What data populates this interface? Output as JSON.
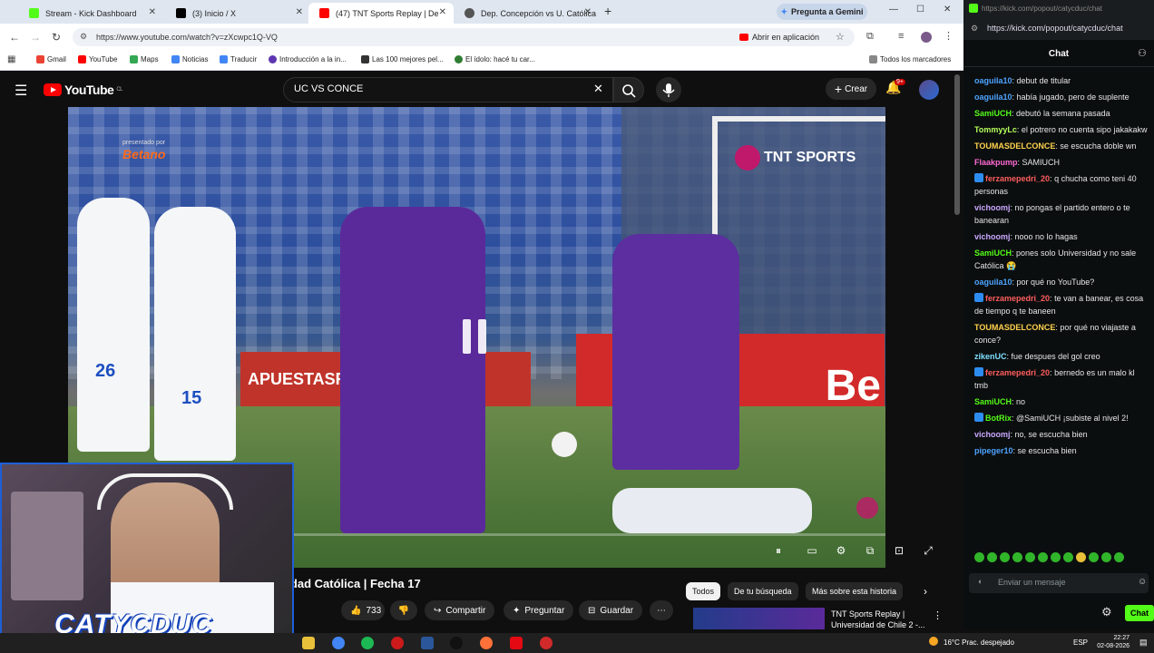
{
  "tabs": [
    {
      "label": "Stream - Kick Dashboard",
      "close": "✕",
      "color": "#53fc18"
    },
    {
      "label": "(3) Inicio / X",
      "close": "✕",
      "color": "#000000"
    },
    {
      "label": "(47) TNT Sports Replay | De",
      "close": "✕",
      "color": "#ff0000"
    },
    {
      "label": "Dep. Concepción vs U. Católica",
      "close": "✕",
      "color": "#555555"
    }
  ],
  "gemini_label": "Pregunta a Gemini",
  "address_url": "https://www.youtube.com/watch?v=zXcwpc1Q-VQ",
  "open_in_app": "Abrir en aplicación",
  "bookmarks": [
    {
      "label": "Gmail",
      "color": "#ea4335"
    },
    {
      "label": "YouTube",
      "color": "#ff0000"
    },
    {
      "label": "Maps",
      "color": "#34a853"
    },
    {
      "label": "Noticias",
      "color": "#4285f4"
    },
    {
      "label": "Traducir",
      "color": "#4285f4"
    },
    {
      "label": "Introducción a la in...",
      "color": "#5e35b1"
    },
    {
      "label": "Las 100 mejores pel...",
      "color": "#333333"
    },
    {
      "label": "El ídolo: hacé tu car...",
      "color": "#2e7d32"
    }
  ],
  "all_bookmarks": "Todos los marcadores",
  "youtube": {
    "logo": "YouTube",
    "logo_sup": "CL",
    "search_value": "UC VS CONCE",
    "create": "Crear",
    "notif_count": "9+",
    "video": {
      "sponsor_small": "presentado por",
      "sponsor": "Betano",
      "channel_bug": "TNT SPORTS",
      "board_text": "APUESTASROYAL",
      "board_right": "Be",
      "jersey_right": "26",
      "jersey_mid": "15",
      "progress": 0.0
    },
    "title": "rsidad Católica | Fecha 17",
    "likes": "733",
    "share": "Compartir",
    "ask": "Preguntar",
    "save": "Guardar",
    "chips": [
      "Todos",
      "De tu búsqueda",
      "Más sobre esta historia"
    ],
    "rec_title": "TNT Sports Replay |",
    "rec_subtitle": "Universidad de Chile 2 -..."
  },
  "webcam": {
    "name": "CATYCDUC"
  },
  "kick": {
    "url": "https://kick.com/popout/catycduc/chat",
    "chat_title": "Chat",
    "messages": [
      {
        "user": "oaguila10",
        "color": "#4da3ff",
        "text": "debut de titular",
        "badge": false
      },
      {
        "user": "oaguila10",
        "color": "#4da3ff",
        "text": "había jugado, pero de suplente",
        "badge": false
      },
      {
        "user": "SamiUCH",
        "color": "#53fc18",
        "text": "debutó la semana pasada",
        "badge": false
      },
      {
        "user": "TommyyLc",
        "color": "#b6ff5c",
        "text": "el potrero no cuenta sipo jakakakw",
        "badge": false
      },
      {
        "user": "TOUMASDELCONCE",
        "color": "#ffd24d",
        "text": "se escucha doble wn",
        "badge": false
      },
      {
        "user": "Flaakpump",
        "color": "#ff6ad5",
        "text": "SAMIUCH",
        "badge": false
      },
      {
        "user": "ferzamepedri_20",
        "color": "#ff5d5d",
        "text": "q chucha como teni 40 personas",
        "badge": true
      },
      {
        "user": "vichoomj",
        "color": "#c9a8ff",
        "text": "no pongas el partido entero o te banearan",
        "badge": false
      },
      {
        "user": "vichoomj",
        "color": "#c9a8ff",
        "text": "nooo no lo hagas",
        "badge": false
      },
      {
        "user": "SamiUCH",
        "color": "#53fc18",
        "text": "pones solo Universidad y no sale Católica 😭",
        "badge": false
      },
      {
        "user": "oaguila10",
        "color": "#4da3ff",
        "text": "por qué no YouTube?",
        "badge": false
      },
      {
        "user": "ferzamepedri_20",
        "color": "#ff5d5d",
        "text": "te van a banear, es cosa de tiempo q te baneen",
        "badge": true
      },
      {
        "user": "TOUMASDELCONCE",
        "color": "#ffd24d",
        "text": "por qué no viajaste a conce?",
        "badge": false
      },
      {
        "user": "zikenUC",
        "color": "#7fe0ff",
        "text": "fue despues del gol creo",
        "badge": false
      },
      {
        "user": "ferzamepedri_20",
        "color": "#ff5d5d",
        "text": "bernedo es un malo kl tmb",
        "badge": true
      },
      {
        "user": "SamiUCH",
        "color": "#53fc18",
        "text": "no",
        "badge": false
      },
      {
        "user": "BotRix",
        "color": "#53fc18",
        "text": "@SamiUCH ¡subiste al nivel 2!",
        "badge": true
      },
      {
        "user": "vichoomj",
        "color": "#c9a8ff",
        "text": "no, se escucha bien",
        "badge": false
      },
      {
        "user": "pipeger10",
        "color": "#4da3ff",
        "text": "se escucha bien",
        "badge": false
      }
    ],
    "input_placeholder": "Enviar un mensaje",
    "send": "Chat"
  },
  "taskbar": {
    "weather": "16°C  Prac. despejado",
    "lang": "ESP",
    "time": "22:27",
    "date": "02-08-2026"
  }
}
